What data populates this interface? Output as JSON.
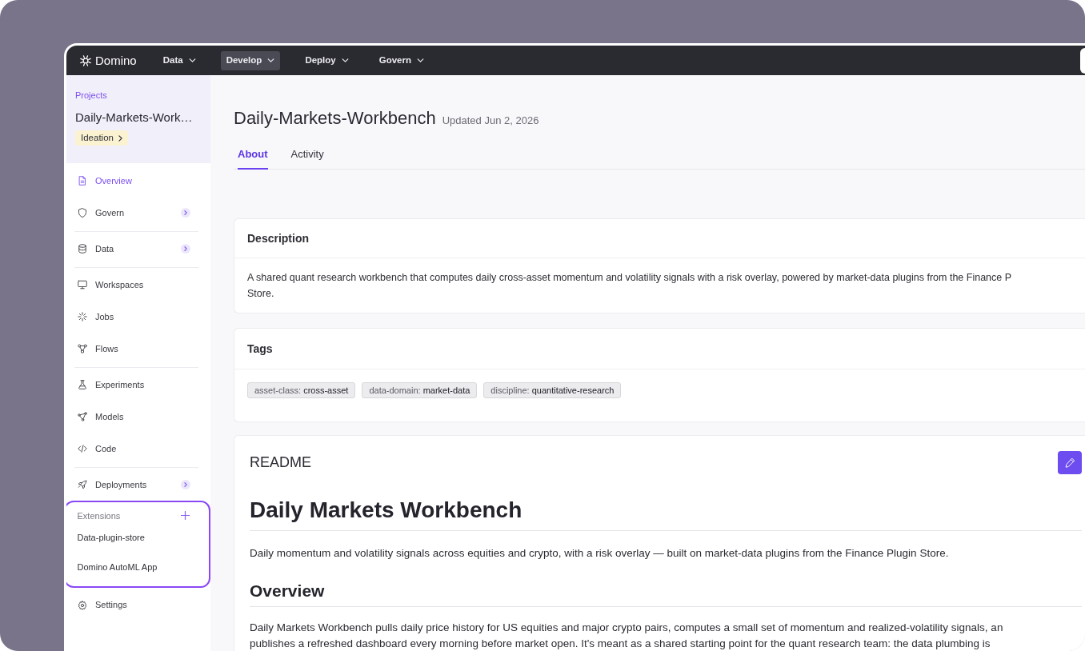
{
  "nav": {
    "logo": "Domino",
    "menus": [
      {
        "label": "Data",
        "selected": false
      },
      {
        "label": "Develop",
        "selected": true
      },
      {
        "label": "Deploy",
        "selected": false
      },
      {
        "label": "Govern",
        "selected": false
      }
    ]
  },
  "sidebar": {
    "breadcrumb": "Projects",
    "project": "Daily-Markets-Work…",
    "stage": "Ideation",
    "groups": [
      {
        "items": [
          {
            "label": "Overview",
            "selected": true,
            "expandable": false
          },
          {
            "label": "Govern",
            "selected": false,
            "expandable": true
          }
        ]
      },
      {
        "items": [
          {
            "label": "Data",
            "selected": false,
            "expandable": true
          }
        ]
      },
      {
        "items": [
          {
            "label": "Workspaces",
            "selected": false,
            "expandable": false
          },
          {
            "label": "Jobs",
            "selected": false,
            "expandable": false
          },
          {
            "label": "Flows",
            "selected": false,
            "expandable": false
          }
        ]
      },
      {
        "items": [
          {
            "label": "Experiments",
            "selected": false,
            "expandable": false
          },
          {
            "label": "Models",
            "selected": false,
            "expandable": false
          },
          {
            "label": "Code",
            "selected": false,
            "expandable": false
          }
        ]
      },
      {
        "items": [
          {
            "label": "Deployments",
            "selected": false,
            "expandable": true
          }
        ]
      }
    ],
    "extensions": {
      "title": "Extensions",
      "items": [
        "Data-plugin-store",
        "Domino AutoML App"
      ]
    },
    "settings": {
      "label": "Settings",
      "selected": false
    }
  },
  "page": {
    "title": "Daily-Markets-Workbench",
    "updated": "Updated Jun 2, 2026",
    "tabs": [
      {
        "label": "About",
        "selected": true
      },
      {
        "label": "Activity",
        "selected": false
      }
    ]
  },
  "description": {
    "title": "Description",
    "lines": [
      "A shared quant research workbench that computes daily cross-asset momentum and volatility signals with a risk overlay, powered by market-data plugins from the Finance P",
      "Store."
    ]
  },
  "tags": {
    "title": "Tags",
    "items": [
      "asset-class: **cross-asset**",
      "data-domain: **market-data**",
      "discipline: **quantitative-research**"
    ]
  },
  "readme": {
    "title": "README",
    "heading": "Daily Markets Workbench",
    "intro": "Daily momentum and volatility signals across equities and crypto, with a risk overlay — built on market-data plugins from the Finance Plugin Store.",
    "sections": [
      {
        "heading": "Overview",
        "lines": [
          "Daily Markets Workbench pulls daily price history for US equities and major crypto pairs, computes a small set of momentum and realized-volatility signals, an",
          "publishes a refreshed dashboard every morning before market open. It's meant as a shared starting point for the quant research team: the data plumbing is"
        ]
      }
    ]
  }
}
